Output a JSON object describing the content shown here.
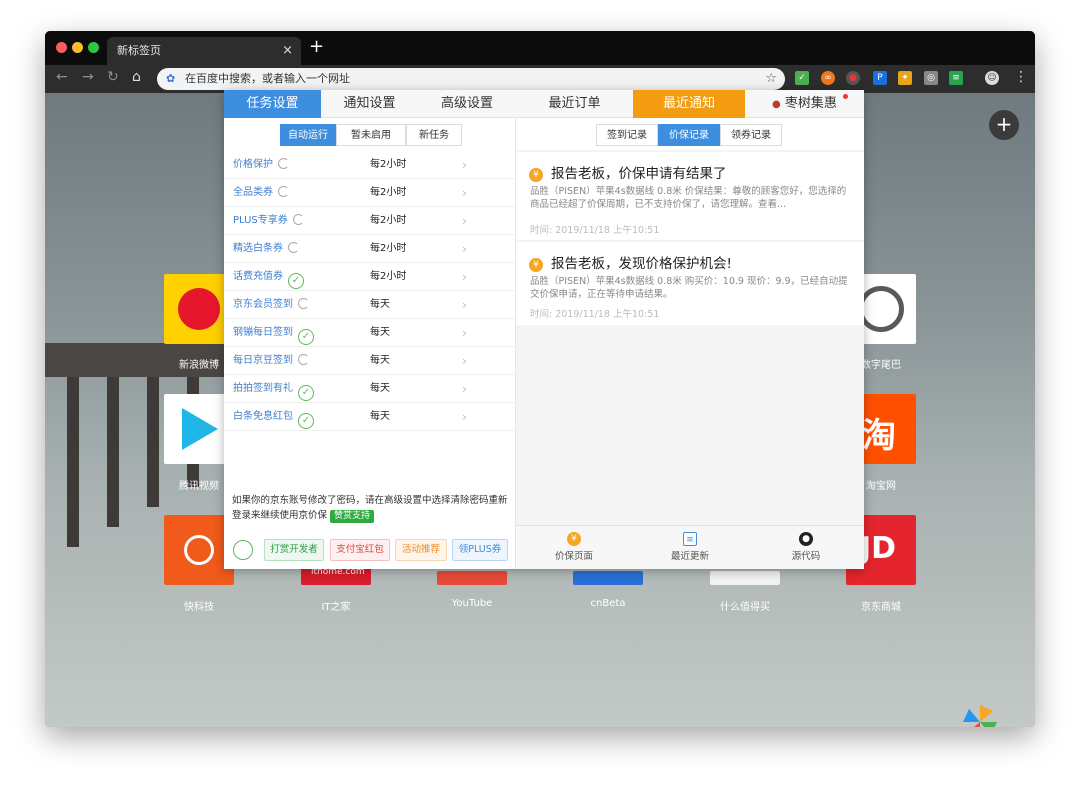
{
  "browser": {
    "tab_title": "新标签页",
    "tab_close": "×",
    "new_tab": "+",
    "omnibox_placeholder": "在百度中搜索，或者输入一个网址"
  },
  "ntp": {
    "add_button": "+",
    "tiles": [
      {
        "label": "新浪微博",
        "color": "#ffd100"
      },
      {
        "label": "腾讯视频",
        "color": "#ffffff"
      },
      {
        "label": "快科技",
        "color": "#f05a1a"
      },
      {
        "label": "IT之家",
        "color": "#d81e2c"
      },
      {
        "label": "YouTube",
        "color": "#e84a3a"
      },
      {
        "label": "cnBeta",
        "color": "#2a6fd6"
      },
      {
        "label": "什么值得买",
        "color": "#f2f2f2"
      },
      {
        "label": "京东商城",
        "color": "#e4252d"
      },
      {
        "label": "数字尾巴",
        "color": "#ffffff"
      },
      {
        "label": "淘宝网",
        "color": "#ff5000"
      }
    ],
    "ithome_text": "ithome.com",
    "jd_text": "JD",
    "taobao_text": "淘"
  },
  "popup": {
    "left_tabs": [
      "任务设置",
      "通知设置",
      "高级设置"
    ],
    "right_tabs": [
      "最近订单",
      "最近通知",
      "枣树集惠"
    ],
    "task_filters": [
      "自动运行",
      "暂未启用",
      "新任务"
    ],
    "record_filters": [
      "签到记录",
      "价保记录",
      "领券记录"
    ],
    "tasks": [
      {
        "name": "价格保护",
        "freq": "每2小时",
        "status": "refresh"
      },
      {
        "name": "全品类券",
        "freq": "每2小时",
        "status": "refresh"
      },
      {
        "name": "PLUS专享券",
        "freq": "每2小时",
        "status": "refresh"
      },
      {
        "name": "精选白条券",
        "freq": "每2小时",
        "status": "refresh"
      },
      {
        "name": "话费充值券",
        "freq": "每2小时",
        "status": "done"
      },
      {
        "name": "京东会员签到",
        "freq": "每天",
        "status": "refresh"
      },
      {
        "name": "钢镚每日签到",
        "freq": "每天",
        "status": "done"
      },
      {
        "name": "每日京豆签到",
        "freq": "每天",
        "status": "refresh"
      },
      {
        "name": "拍拍签到有礼",
        "freq": "每天",
        "status": "done"
      },
      {
        "name": "白条免息红包",
        "freq": "每天",
        "status": "done"
      }
    ],
    "arrow": "›",
    "notice_text": "如果你的京东账号修改了密码，请在高级设置中选择清除密码重新登录来继续使用京价保",
    "support_label": "赞赏支持",
    "bottom_buttons": [
      "打赏开发者",
      "支付宝红包",
      "活动推荐",
      "领PLUS券"
    ],
    "notifications": [
      {
        "title": "报告老板，价保申请有结果了",
        "body": "品胜（PISEN）苹果4s数据线 0.8米 价保结果：尊敬的顾客您好，您选择的商品已经超了价保周期，已不支持价保了，请您理解。查看...",
        "time": "时间: 2019/11/18 上午10:51"
      },
      {
        "title": "报告老板，发现价格保护机会!",
        "body": "品胜（PISEN）苹果4s数据线 0.8米 购买价：10.9 现价：9.9，已经自动提交价保申请，正在等待申请结果。",
        "time": "时间: 2019/11/18 上午10:51"
      }
    ],
    "footer": [
      "价保页面",
      "最近更新",
      "源代码"
    ]
  }
}
